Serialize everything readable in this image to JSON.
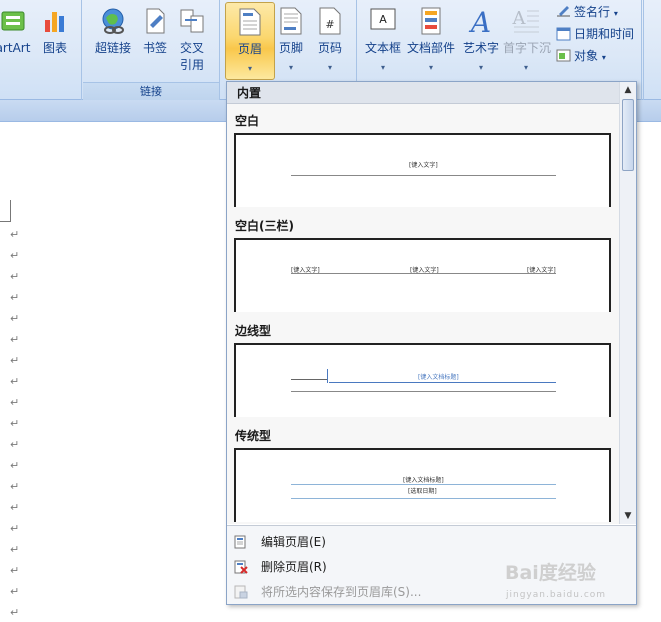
{
  "ribbon": {
    "buttons": {
      "smartart": "artArt",
      "chart": "图表",
      "hyperlink": "超链接",
      "bookmark": "书签",
      "cross_ref_1": "交叉",
      "cross_ref_2": "引用",
      "header": "页眉",
      "footer": "页脚",
      "page_number": "页码",
      "textbox": "文本框",
      "quick_parts": "文档部件",
      "wordart": "艺术字",
      "dropcap": "首字下沉"
    },
    "small_buttons": {
      "signature_line": "签名行",
      "date_time": "日期和时间",
      "object": "对象"
    },
    "groups": {
      "links": "链接"
    }
  },
  "gallery": {
    "header": "内置",
    "sections": [
      {
        "title": "空白",
        "texts": [
          "[键入文字]"
        ]
      },
      {
        "title": "空白(三栏)",
        "texts": [
          "[键入文字]",
          "[键入文字]",
          "[键入文字]"
        ]
      },
      {
        "title": "边线型",
        "texts": [
          "[键入文档标题]"
        ]
      },
      {
        "title": "传统型",
        "texts": [
          "[键入文档标题]",
          "[选取日期]"
        ]
      }
    ],
    "menu": {
      "edit": "编辑页眉(E)",
      "remove": "删除页眉(R)",
      "save": "将所选内容保存到页眉库(S)..."
    }
  },
  "document": {
    "paragraph_mark": "↵"
  },
  "watermark": {
    "brand": "Bai度经验",
    "url": "jingyan.baidu.com"
  },
  "colors": {
    "ribbon_text": "#15428b",
    "active_button": "#f9c74b"
  }
}
